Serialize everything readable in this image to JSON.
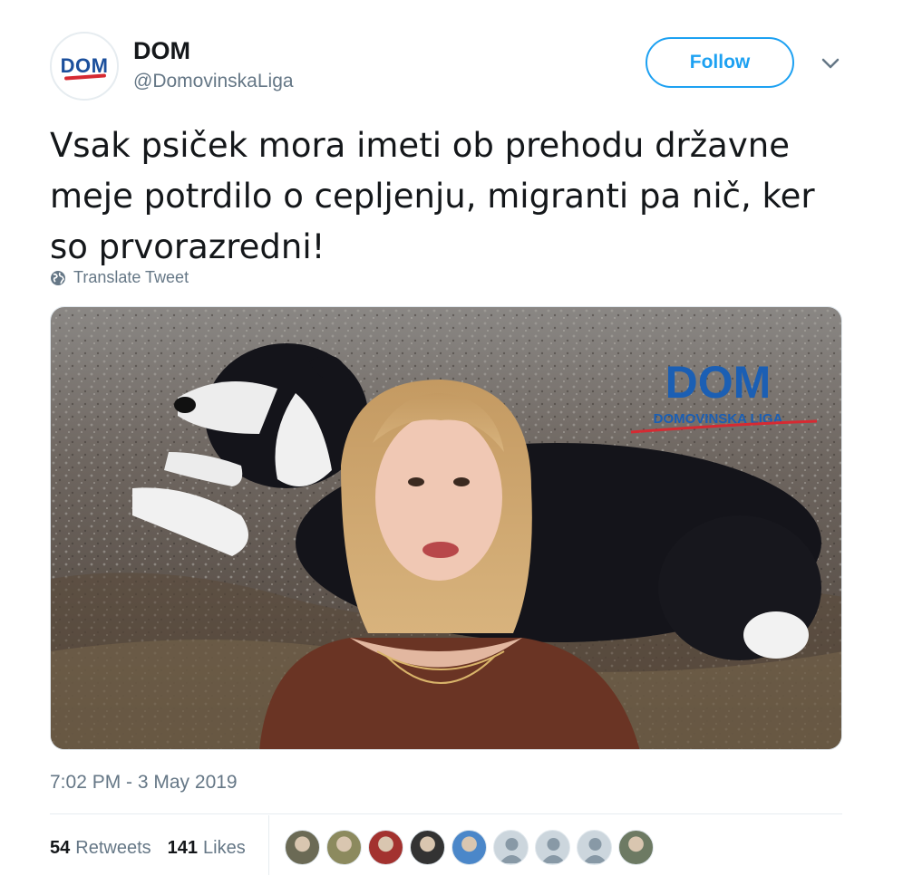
{
  "author": {
    "avatar_text": "DOM",
    "name": "DOM",
    "handle": "@DomovinskaLiga"
  },
  "follow_label": "Follow",
  "tweet": {
    "line1": "Vsak psiček mora imeti ob prehodu državne",
    "line2": "meje potrdilo o cepljenju, migranti pa nič, ker",
    "line3": "so prvorazredni!"
  },
  "translate_label": "Translate Tweet",
  "media": {
    "watermark_title": "DOM",
    "watermark_subtitle": "DOMOVINSKA LIGA"
  },
  "timestamp": "7:02 PM - 3 May 2019",
  "stats": {
    "retweets_count": "54",
    "retweets_label": "Retweets",
    "likes_count": "141",
    "likes_label": "Likes"
  },
  "likers": [
    {
      "icon": "liker-avatar-1",
      "color": "#6b6a55"
    },
    {
      "icon": "liker-avatar-2",
      "color": "#8c8a5e"
    },
    {
      "icon": "liker-avatar-3",
      "color": "#a3322f"
    },
    {
      "icon": "liker-avatar-4",
      "color": "#333333"
    },
    {
      "icon": "liker-avatar-5",
      "color": "#4b87c9"
    },
    {
      "icon": "default-avatar-icon",
      "color": "#ccd6dd"
    },
    {
      "icon": "default-avatar-icon",
      "color": "#ccd6dd"
    },
    {
      "icon": "default-avatar-icon",
      "color": "#ccd6dd"
    },
    {
      "icon": "liker-avatar-9",
      "color": "#6d7a63"
    }
  ],
  "colors": {
    "accent": "#1da1f2",
    "text": "#14171a",
    "muted": "#657786",
    "brand_blue": "#1b4f9c",
    "brand_red": "#d62a32"
  }
}
